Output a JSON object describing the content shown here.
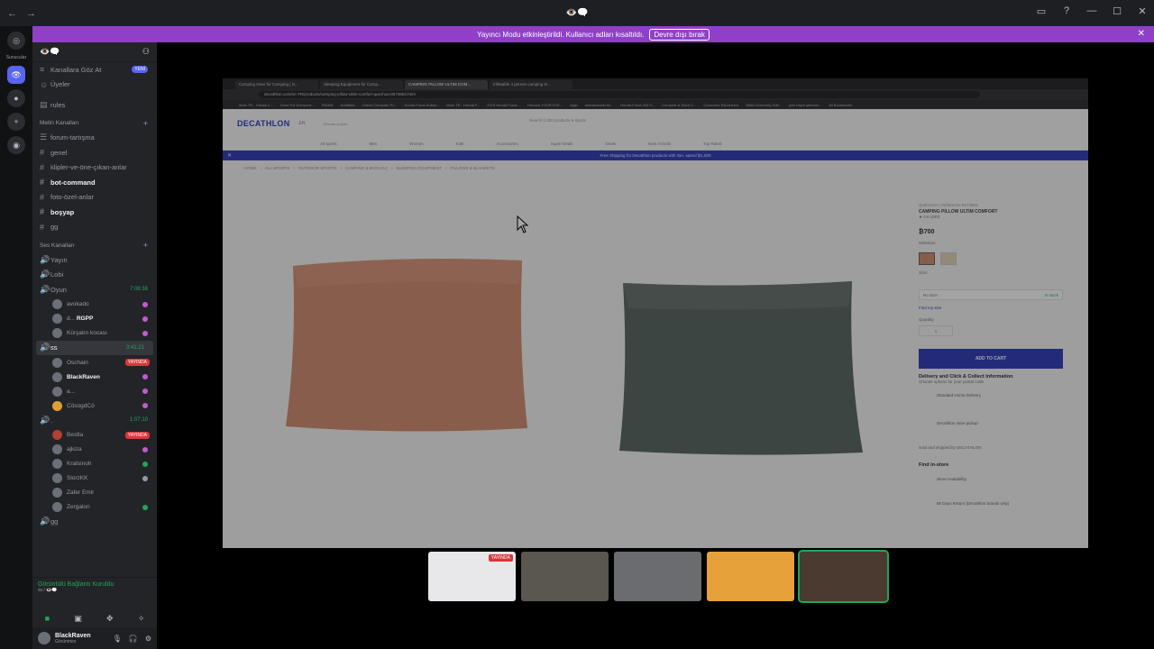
{
  "window": {
    "title": "👁️🗨️",
    "controls": [
      "▭",
      "?",
      "—",
      "☐",
      "✕"
    ]
  },
  "banner": {
    "text": "Yayıncı Modu etkinleştirildi. Kullanıcı adları kısaltıldı.",
    "button": "Devre dışı bırak"
  },
  "servers": {
    "label": "Sunucular"
  },
  "sidebar": {
    "server_name": "👁️🗨️",
    "top_items": [
      {
        "label": "Kanallara Göz At",
        "badge": "YENİ"
      },
      {
        "label": "Üyeler"
      },
      {
        "label": "rules"
      }
    ],
    "text_category": "Metin Kanalları",
    "text_channels": [
      {
        "label": "forum-tartışma",
        "bold": false
      },
      {
        "label": "genel",
        "bold": false
      },
      {
        "label": "klipler-ve-öne-çıkan-anlar",
        "bold": false
      },
      {
        "label": "bot-command",
        "bold": true
      },
      {
        "label": "foto-özel-anlar",
        "bold": false
      },
      {
        "label": "boşyap",
        "bold": true
      },
      {
        "label": "gg",
        "bold": false
      }
    ],
    "voice_category": "Ses Kanalları",
    "voice_channels": [
      {
        "label": "Yayın"
      },
      {
        "label": "Lobi"
      },
      {
        "label": "Oyun",
        "timer": "7:08:38"
      }
    ],
    "oyun_users": [
      "avokado",
      "d...",
      "Kürşatın kocası"
    ],
    "oyun_user_tag": "RGPP",
    "ss_channel": {
      "label": "ss",
      "timer": "3:41:21"
    },
    "ss_users": [
      {
        "label": "Oschain",
        "live": "YAYINDA"
      },
      {
        "label": "BlackRaven",
        "bold": true
      },
      {
        "label": "a..."
      },
      {
        "label": "CösogdCö"
      }
    ],
    "third_channel": {
      "label": ".",
      "timer": "1:07:10"
    },
    "third_users": [
      {
        "label": "Bestla",
        "live": "YAYINDA"
      },
      {
        "label": "ajkiza"
      },
      {
        "label": "Kratsinoh"
      },
      {
        "label": "SlorzKK"
      },
      {
        "label": "Zafer Emir"
      },
      {
        "label": "Zergalon"
      }
    ],
    "last_channel": "gg"
  },
  "voice": {
    "status": "Görüntülü Bağlantı Kuruldu",
    "sub": "ss / 👁️🗨️"
  },
  "user": {
    "name": "BlackRaven",
    "status": "Görünmez"
  },
  "browser": {
    "tabs": [
      "Camping Gear for Camping | D...",
      "Sleeping Equipment for Camp...",
      "CAMPING PILLOW ULTIM COM...",
      "Inflatable 4 person camping te..."
    ],
    "url": "decathlon.com/en-TR/products/camping-pillow-ultim-comfort-quechua-8673663.html",
    "bookmarks": [
      "Moto TR - Honda C...",
      "Done For Everyone...",
      "RIZAM",
      "ArabBike",
      "Check Computer P.I...",
      "Honda Forza Kullan...",
      "Moto TR - Honda F...",
      "2019 Honda Forza...",
      "Fabrock YOUR EVE...",
      "login",
      "arabasındaki bir...",
      "Honda Forza 400 S...",
      "Compute & Store C...",
      "Consumer Electronics",
      "MMA University Onli...",
      "yeni hayal şaheser...",
      "All Bookmarks"
    ]
  },
  "site": {
    "logo": "DECATHLON",
    "lang": "EN",
    "location": "Choose a store",
    "search_placeholder": "Search 1.000 products & sports",
    "nav": [
      "All sports",
      "Men",
      "Women",
      "Kids",
      "Accessories",
      "Super Deals",
      "Deals",
      "New Arrivals",
      "Top Rated"
    ],
    "promo": "Free Shipping for Decathlon products with min. spend ₿1,500",
    "breadcrumbs": [
      "HOME",
      "ALL SPORTS",
      "OUTDOOR SPORTS",
      "CAMPING & BIVOUAC",
      "SLEEPING EQUIPMENT",
      "PILLOWS & BLANKETS"
    ]
  },
  "product": {
    "brand": "QUECHUA | Reference 8673663",
    "name": "CAMPING PILLOW ULTIM COMFORT",
    "rating": "★ 4.8 (340)",
    "price": "₿700",
    "color_label": "Selection",
    "size_label": "Size:",
    "size_value": "No Size",
    "size_stock": "In stock",
    "size_guide": "Find my size",
    "qty_label": "Quantity",
    "qty_value": "1",
    "add_to_cart": "ADD TO CART",
    "delivery_title": "Delivery and Click & Collect Information",
    "delivery_sub": "Choose options for your postal code",
    "home_delivery": "Standard Home Delivery",
    "store_pickup": "Decathlon store pickup",
    "sold_by": "Sold and shipped by DECATHLON",
    "find_in_store": "Find in-store",
    "store_avail": "Store Availability",
    "returns": "90 Days Return (Decathlon brands only)",
    "colors": [
      "#d19073",
      "#e4d3bb"
    ]
  },
  "tiles": [
    {
      "live": "YAYINDA"
    },
    {},
    {},
    {},
    {}
  ]
}
